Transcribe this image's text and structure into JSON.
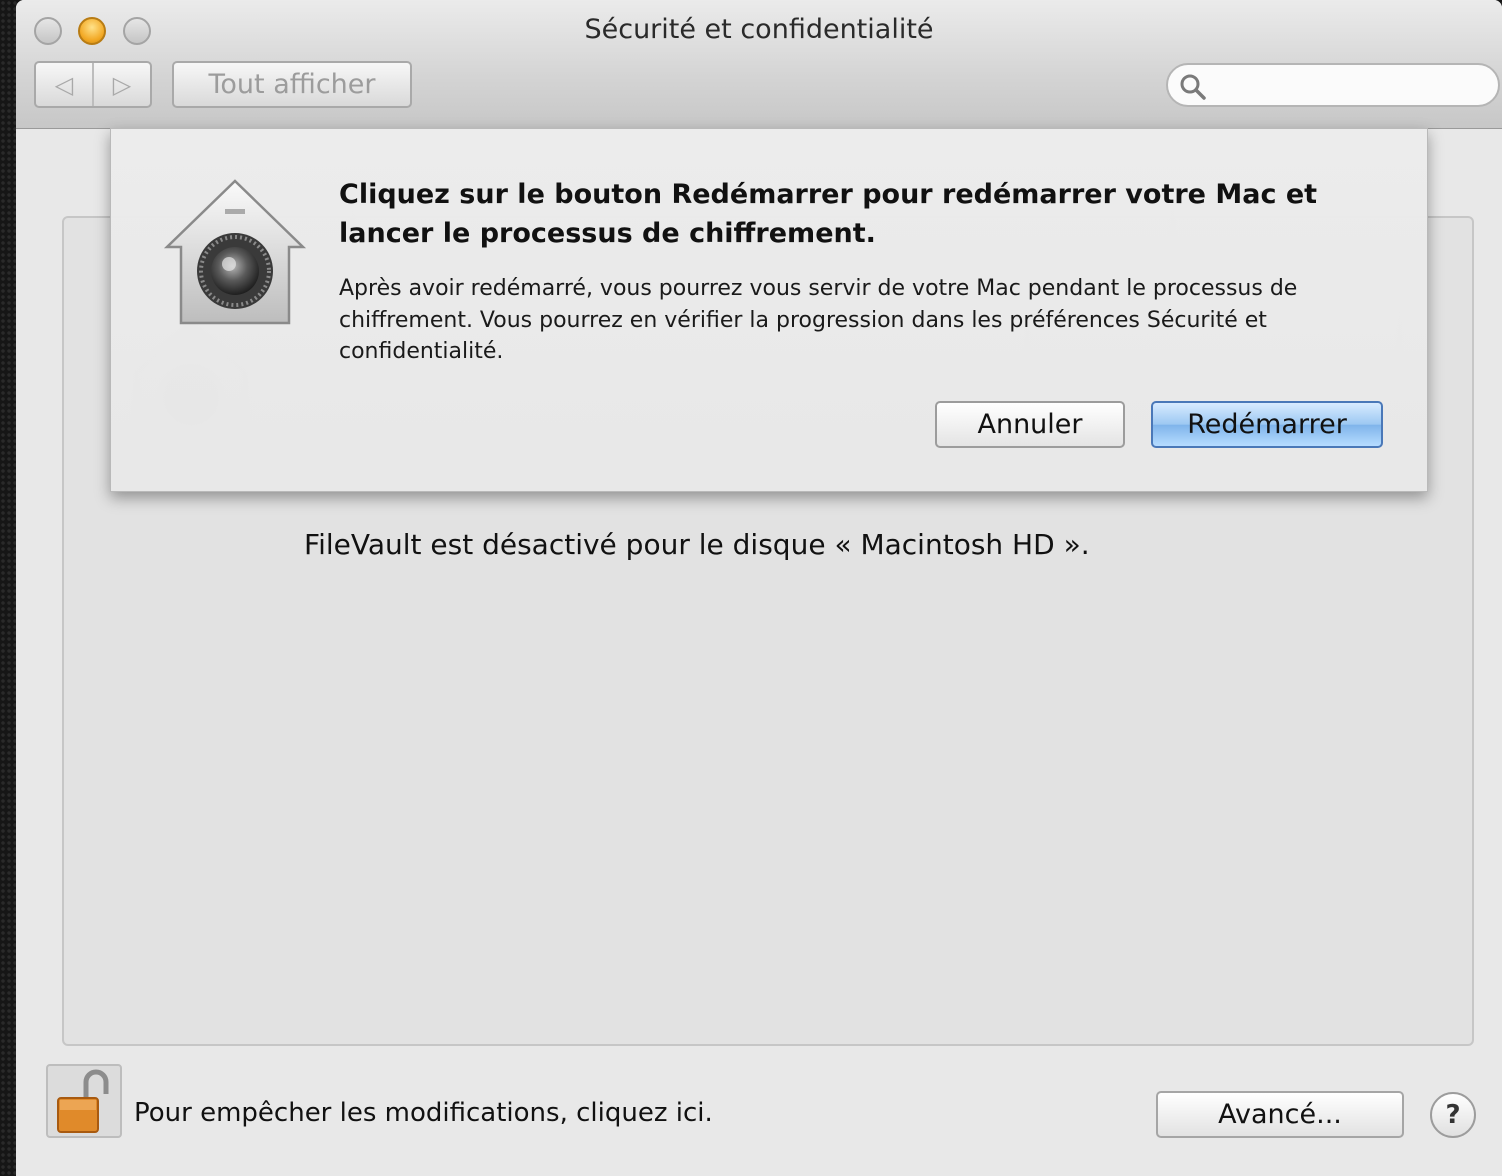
{
  "window": {
    "title": "Sécurité et confidentialité"
  },
  "toolbar": {
    "back_glyph": "◁",
    "forward_glyph": "▷",
    "show_all_label": "Tout afficher",
    "search_placeholder": "",
    "search_icon": "magnifier-icon"
  },
  "sheet": {
    "title": "Cliquez sur le bouton Redémarrer pour redémarrer votre Mac et lancer le processus de chiffrement.",
    "body": "Après avoir redémarré, vous pourrez vous servir de votre Mac pendant le processus de chiffrement. Vous pourrez en vérifier la progression dans les préférences Sécurité et confidentialité.",
    "icon": "filevault-icon",
    "cancel_label": "Annuler",
    "restart_label": "Redémarrer"
  },
  "main": {
    "status_text": "FileVault est désactivé pour le disque « Macintosh HD »."
  },
  "footer": {
    "lock_icon": "unlocked-padlock-icon",
    "lock_text": "Pour empêcher les modifications, cliquez ici.",
    "advanced_label": "Avancé...",
    "help_label": "?"
  },
  "colors": {
    "default_button": "#8fc0ef",
    "minimize_light": "#f2a824"
  }
}
